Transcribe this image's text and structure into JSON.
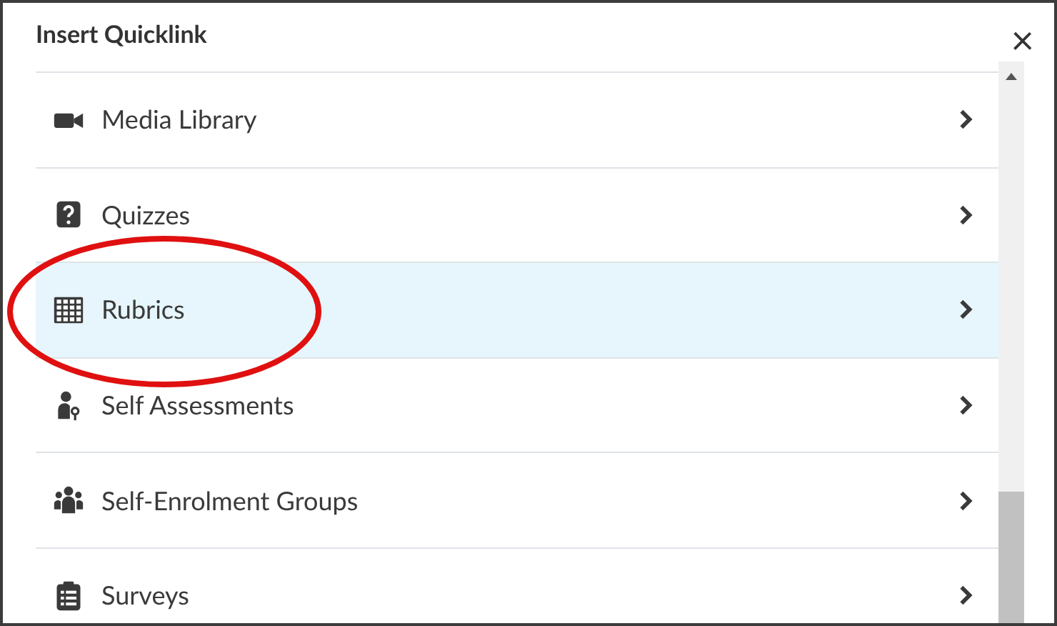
{
  "dialog": {
    "title": "Insert Quicklink",
    "close": "×"
  },
  "items": [
    {
      "label": "Media Library",
      "selected": false
    },
    {
      "label": "Quizzes",
      "selected": false
    },
    {
      "label": "Rubrics",
      "selected": true
    },
    {
      "label": "Self Assessments",
      "selected": false
    },
    {
      "label": "Self-Enrolment Groups",
      "selected": false
    },
    {
      "label": "Surveys",
      "selected": false
    }
  ]
}
